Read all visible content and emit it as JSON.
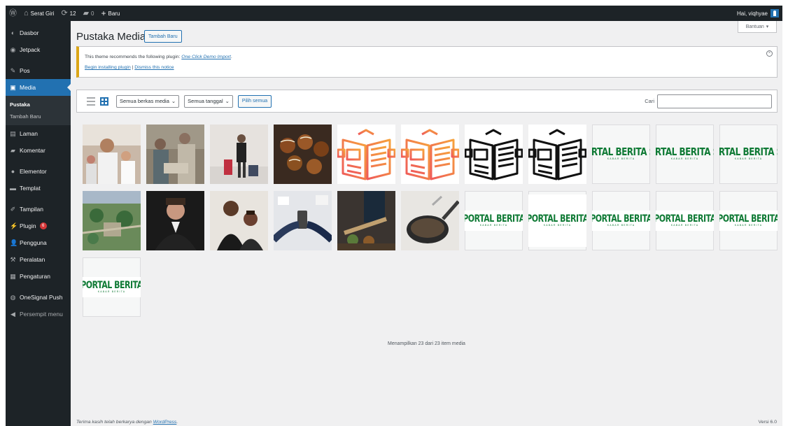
{
  "adminbar": {
    "site_name": "Serat Giri",
    "updates_count": "12",
    "comments_count": "0",
    "new_label": "Baru",
    "greeting": "Hai, viqhyae"
  },
  "sidebar": {
    "items": [
      {
        "label": "Dasbor",
        "icon": "dashboard-icon"
      },
      {
        "label": "Jetpack",
        "icon": "jetpack-icon"
      },
      {
        "label": "Pos",
        "icon": "pin-icon"
      },
      {
        "label": "Media",
        "icon": "media-icon"
      },
      {
        "label": "Laman",
        "icon": "page-icon"
      },
      {
        "label": "Komentar",
        "icon": "comment-icon"
      },
      {
        "label": "Elementor",
        "icon": "elementor-icon"
      },
      {
        "label": "Templat",
        "icon": "folder-icon"
      },
      {
        "label": "Tampilan",
        "icon": "brush-icon"
      },
      {
        "label": "Plugin",
        "icon": "plugin-icon",
        "badge": "6"
      },
      {
        "label": "Pengguna",
        "icon": "user-icon"
      },
      {
        "label": "Peralatan",
        "icon": "wrench-icon"
      },
      {
        "label": "Pengaturan",
        "icon": "settings-icon"
      },
      {
        "label": "OneSignal Push",
        "icon": "onesignal-icon"
      },
      {
        "label": "Persempit menu",
        "icon": "collapse-icon"
      }
    ],
    "media_sub": [
      "Pustaka",
      "Tambah Baru"
    ]
  },
  "help_label": "Bantuan",
  "page_title": "Pustaka Media",
  "add_new_label": "Tambah Baru",
  "notice": {
    "text": "This theme recommends the following plugin:",
    "plugin_link": "One Click Demo Import",
    "period": ".",
    "begin_link": "Begin installing plugin",
    "separator": " | ",
    "dismiss_link": "Dismiss this notice"
  },
  "toolbar": {
    "type_filter": "Semua berkas media",
    "date_filter": "Semua tanggal",
    "bulk_select": "Pilih semua",
    "search_label": "Cari",
    "search_value": ""
  },
  "media_items": [
    {
      "kind": "photo",
      "subject": "man-with-microphone"
    },
    {
      "kind": "photo",
      "subject": "people-cooking"
    },
    {
      "kind": "photo",
      "subject": "man-with-luggage"
    },
    {
      "kind": "photo",
      "subject": "takoyaki-food"
    },
    {
      "kind": "icon",
      "subject": "newspaper-gradient-icon"
    },
    {
      "kind": "icon",
      "subject": "newspaper-gradient-icon"
    },
    {
      "kind": "icon",
      "subject": "newspaper-black-icon"
    },
    {
      "kind": "icon",
      "subject": "newspaper-black-icon"
    },
    {
      "kind": "logo-crop",
      "subject": "portal-berita-logo"
    },
    {
      "kind": "logo-crop",
      "subject": "portal-berita-logo"
    },
    {
      "kind": "logo-crop",
      "subject": "portal-berita-logo"
    },
    {
      "kind": "photo",
      "subject": "aerial-park"
    },
    {
      "kind": "photo",
      "subject": "elon-musk"
    },
    {
      "kind": "photo",
      "subject": "couple-formal"
    },
    {
      "kind": "photo",
      "subject": "desk-phone"
    },
    {
      "kind": "photo",
      "subject": "chef-cooking"
    },
    {
      "kind": "photo",
      "subject": "frying-pan"
    },
    {
      "kind": "logo",
      "subject": "portal-berita-logo"
    },
    {
      "kind": "logo",
      "subject": "portal-berita-logo"
    },
    {
      "kind": "logo",
      "subject": "portal-berita-logo"
    },
    {
      "kind": "logo",
      "subject": "portal-berita-logo"
    },
    {
      "kind": "logo",
      "subject": "portal-berita-logo"
    },
    {
      "kind": "logo",
      "subject": "portal-berita-logo"
    }
  ],
  "logo_text": {
    "title": "PORTAL BERITA",
    "title_cropped": "ORTAL BERITA SI",
    "tagline": "KABAR BERITA"
  },
  "count_text": "Menampilkan 23 dari 23 item media",
  "footer": {
    "prefix": "Terima kasih telah berkarya dengan",
    "link": "WordPress",
    "suffix": "."
  },
  "version": "Versi 6.0",
  "colors": {
    "accent": "#2271b1",
    "sidebar": "#1d2327",
    "logo_green": "#0f7a35",
    "notice_border": "#dba617"
  }
}
